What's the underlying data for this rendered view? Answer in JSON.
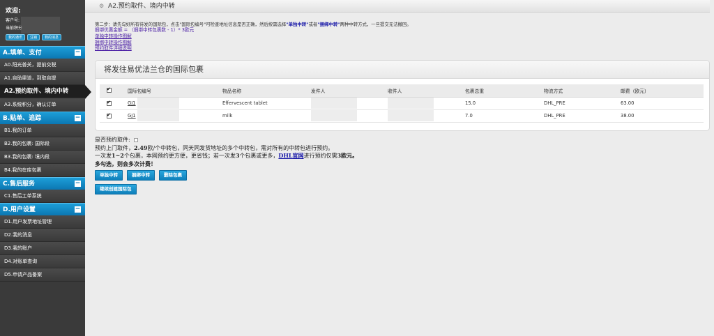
{
  "welcome": {
    "title": "欢迎:",
    "account_label": "客户号:",
    "points_label": "当前积分",
    "buttons": [
      "我的通讯",
      "注销",
      "我的消息"
    ]
  },
  "sidebar": {
    "sections": [
      {
        "title": "A.填单、支付",
        "toggle": "−",
        "items": [
          "A0.阳光普关，提前交税",
          "A1.自助渠道，到取自提",
          "A2.预约取件、境内中转",
          "A3.系统积分，确认订单"
        ]
      },
      {
        "title": "B.贴单、追踪",
        "toggle": "−",
        "items": [
          "B1.我的订单",
          "B2.我的包裹: 国际段",
          "B3.我的包裹: 境内段",
          "B4.我的在库包裹"
        ]
      },
      {
        "title": "C.售后服务",
        "toggle": "−",
        "items": [
          "C1.售后工单系统"
        ]
      },
      {
        "title": "D.用户设置",
        "toggle": "−",
        "items": [
          "D1.用户发票地址管理",
          "D2.我的消息",
          "D3.我的账户",
          "D4.对账单查询",
          "D5.申请产品备案"
        ]
      }
    ],
    "active_item": "A2.预约取件、境内中转"
  },
  "header": {
    "title": "A2.预约取件、境内中转"
  },
  "instructions": {
    "step_text_pre": "第二步：请先勾好所有待发的国际包，点击\"国际包编号\"可检查地址信息是否正确，然后按需选择",
    "single_transfer": "\"单独中转\"",
    "or": "或者",
    "bundle_transfer": "\"捆绑中转\"",
    "step_text_post": "两种中转方式，一旦提交无法撤回。",
    "discount_line": "捆绑优惠金额 = （捆绑中转包裹数 - 1）* 3欧元",
    "links": [
      "单独中转操作图解",
      "捆绑中转操作图解",
      "预约取件详细说明"
    ]
  },
  "panel": {
    "title": "将发往易优法兰仓的国际包裹",
    "columns": [
      "国际包编号",
      "物品名称",
      "发件人",
      "收件人",
      "包裹总重",
      "物流方式",
      "邮费（欧元）"
    ],
    "rows": [
      {
        "id": "GJ1",
        "item": "Effervescent tablet",
        "weight": "15.0",
        "shipping": "DHL_PRE",
        "postage": "63.00"
      },
      {
        "id": "GJ1",
        "item": "milk",
        "weight": "7.0",
        "shipping": "DHL_PRE",
        "postage": "38.00"
      }
    ]
  },
  "pickup": {
    "label": "是否预约取件:",
    "line1_pre": "预约上门取件，",
    "line1_price": "2.49",
    "line1_post": "欧/个中转包，同天同发货地址的多个中转包，需对所有的中转包进行预约。",
    "line2_pre": "一次发",
    "line2_b1": "1~2",
    "line2_mid": "个包裹，本网预约更方便，更省钱；若一次发",
    "line2_b2": "3",
    "line2_mid2": "个包裹或更多，",
    "dhl_link": "DHL官网",
    "line2_post": "进行预约仅需",
    "line2_b3": "3",
    "line2_end": "欧元。",
    "line3": "多勾选，则会多次计费！"
  },
  "actions": {
    "single": "单独中转",
    "bundle": "捆绑中转",
    "delete": "删除包裹",
    "continue": "继续创建国际包"
  }
}
